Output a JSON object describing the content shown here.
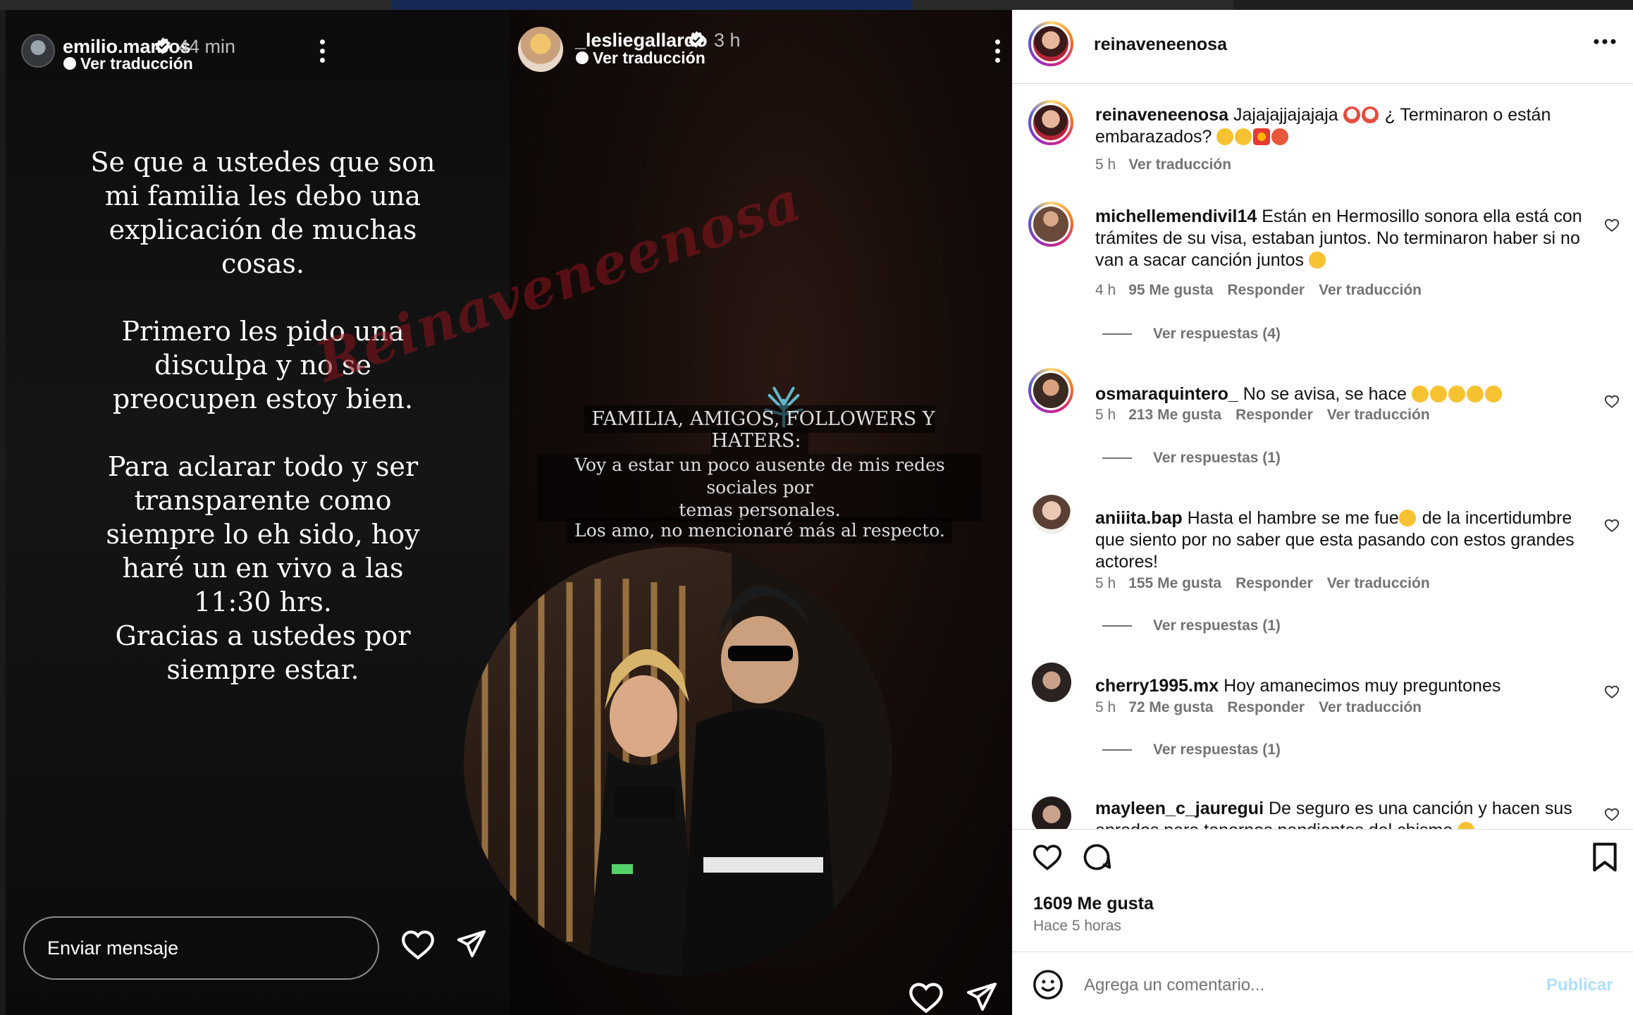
{
  "stories": [
    {
      "username": "emilio.marcos",
      "time": "44 min",
      "translate_label": "Ver traducción",
      "text": "Se que a ustedes que son\nmi familia les debo una\nexplicación de muchas\ncosas.\n\nPrimero les pido una\ndisculpa y no se\npreocupen estoy bien.\n\nPara aclarar todo y ser\ntransparente como\nsiempre lo eh sido, hoy\nharé un en vivo a las\n11:30 hrs.\nGracias a ustedes por\nsiempre estar.",
      "message_placeholder": "Enviar mensaje"
    },
    {
      "username": "_lesliegallardo",
      "time": "3 h",
      "translate_label": "Ver traducción",
      "caption_heading": "FAMILIA, AMIGOS, FOLLOWERS Y HATERS:",
      "caption_line1": "Voy a estar un poco ausente de mis redes sociales por",
      "caption_line2": "temas personales.",
      "caption_line3": "Los amo, no mencionaré más al respecto."
    }
  ],
  "watermark": "Reinaveneenosa",
  "post": {
    "author": "reinaveneenosa",
    "more_icon": "more-horizontal-icon",
    "comments": [
      {
        "username": "reinaveneenosa",
        "text_a": "Jajajajjajajaja",
        "text_b": "¿ Terminaron o están",
        "text_c": "embarazados?",
        "time": "5 h",
        "translate": "Ver traducción"
      },
      {
        "username": "michellemendivil14",
        "text": "Están en Hermosillo sonora ella está con trámites de su visa, estaban juntos. No terminaron haber si no van a sacar canción juntos",
        "time": "4 h",
        "likes": "95 Me gusta",
        "reply": "Responder",
        "translate": "Ver traducción",
        "replies": "Ver respuestas (4)"
      },
      {
        "username": "osmaraquintero_",
        "text": "No se avisa, se hace",
        "time": "5 h",
        "likes": "213 Me gusta",
        "reply": "Responder",
        "translate": "Ver traducción",
        "replies": "Ver respuestas (1)"
      },
      {
        "username": "aniiita.bap",
        "text_a": "Hasta el hambre se me fue",
        "text_b": "de la incertidumbre que siento por no saber que esta pasando con estos grandes actores!",
        "time": "5 h",
        "likes": "155 Me gusta",
        "reply": "Responder",
        "translate": "Ver traducción",
        "replies": "Ver respuestas (1)"
      },
      {
        "username": "cherry1995.mx",
        "text": "Hoy amanecimos muy preguntones",
        "time": "5 h",
        "likes": "72 Me gusta",
        "reply": "Responder",
        "translate": "Ver traducción",
        "replies": "Ver respuestas (1)"
      },
      {
        "username": "mayleen_c_jauregui",
        "text": "De seguro es una canción y hacen sus enredos para tenernos pendientes del chisme"
      }
    ],
    "likes": "1609 Me gusta",
    "ago": "Hace 5 horas",
    "add_comment_placeholder": "Agrega un comentario...",
    "publish_label": "Publicar"
  },
  "colors": {
    "publish_disabled": "#b2dffc",
    "meta_gray": "#737373",
    "avatar_ring": "#d62976"
  }
}
